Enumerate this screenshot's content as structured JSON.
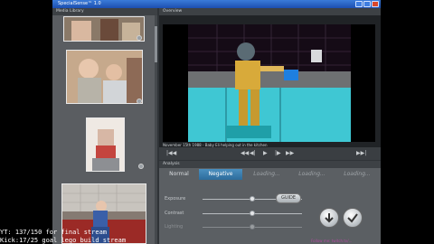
{
  "window": {
    "title": "SpecialSense™ 1.0",
    "controls": [
      "minimize-icon",
      "maximize-icon",
      "close-icon"
    ]
  },
  "media_library": {
    "header": "Media Library"
  },
  "overview": {
    "header": "Overview",
    "caption": "November 15th 1988 - Baby Eli helping out in the kitchen"
  },
  "transport": {
    "rewind_label": "|◀◀",
    "prev_label": "◀◀",
    "prev_frame_label": "◀|",
    "play_label": "▶",
    "next_frame_label": "|▶",
    "next_label": "▶▶",
    "forward_label": "▶▶|"
  },
  "analysis": {
    "header": "Analysis",
    "tabs": [
      {
        "label": "Normal",
        "state": "inactive"
      },
      {
        "label": "Negative",
        "state": "active"
      },
      {
        "label": "Loading...",
        "state": "loading"
      },
      {
        "label": "Loading...",
        "state": "loading"
      },
      {
        "label": "Loading...",
        "state": "loading"
      }
    ],
    "sliders": [
      {
        "label": "Exposure",
        "value": 0.5
      },
      {
        "label": "Contrast",
        "value": 0.5
      },
      {
        "label": "Lighting",
        "value": 0.5
      }
    ],
    "guide_label": "GUIDE",
    "buttons": [
      "down-arrow-icon",
      "check-icon"
    ]
  },
  "stream_overlay": {
    "line1": "YT: 137/150 for final stream",
    "line2": "Kick:17/25 goal lego build stream"
  },
  "footer": {
    "text": "Follow me: twitch.tv/..."
  },
  "colors": {
    "titlebar": "#1c4fb0",
    "active_tab": "#2d6c9b",
    "panel_bg": "#5a5d61"
  }
}
